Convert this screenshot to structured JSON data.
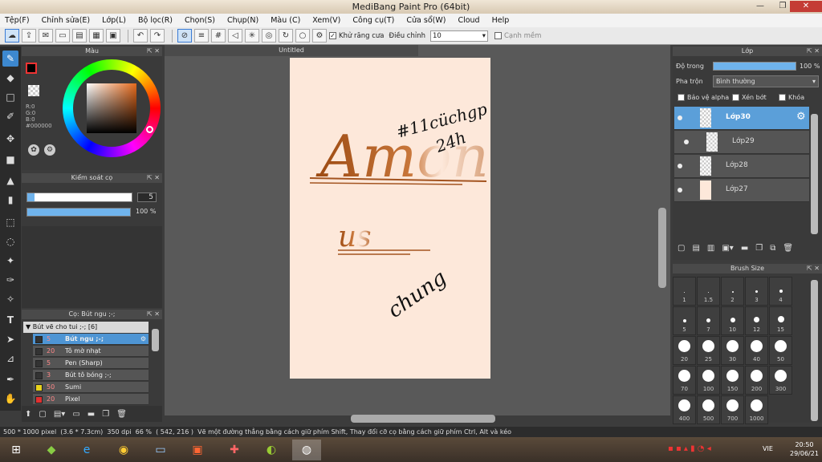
{
  "window": {
    "title": "MediBang Paint Pro (64bit)"
  },
  "menu": [
    "Tệp(F)",
    "Chỉnh sửa(E)",
    "Lớp(L)",
    "Bộ lọc(R)",
    "Chọn(S)",
    "Chụp(N)",
    "Màu (C)",
    "Xem(V)",
    "Công cụ(T)",
    "Cửa sổ(W)",
    "Cloud",
    "Help"
  ],
  "toolbar": {
    "antialias_label": "Khử răng cưa",
    "correction_label": "Điều chỉnh",
    "correction_value": "10",
    "edge_label": "Cạnh mềm"
  },
  "color_panel": {
    "title": "Màu",
    "r": "R:0",
    "g": "G:0",
    "b": "B:0",
    "hex": "#000000"
  },
  "brush_control": {
    "title": "Kiểm soát cọ",
    "size": "5",
    "opacity": "100 %",
    "opacity_fraction": 1.0
  },
  "brush_list": {
    "title": "Cọ: Bút ngu ;-;",
    "group": "Bút vẽ cho tui ;-; [6]",
    "items": [
      {
        "size": "5",
        "name": "Bút ngu ;-;",
        "color": "#333333",
        "selected": true
      },
      {
        "size": "20",
        "name": "Tô mờ nhạt",
        "color": "#333333",
        "selected": false
      },
      {
        "size": "5",
        "name": "Pen (Sharp)",
        "color": "#333333",
        "selected": false
      },
      {
        "size": "3",
        "name": "Bút tô bóng ;-;",
        "color": "#333333",
        "selected": false
      },
      {
        "size": "50",
        "name": "Sumi",
        "color": "#e8d21c",
        "selected": false
      },
      {
        "size": "20",
        "name": "Pixel",
        "color": "#e03030",
        "selected": false
      }
    ]
  },
  "canvas": {
    "tab": "Untitled",
    "text_main": "Among",
    "text_us": "us",
    "text_hashtag": "#11cüchgp",
    "text_24": "24h",
    "text_chung": "chung"
  },
  "layer_panel": {
    "title": "Lớp",
    "opacity_label": "Độ trong",
    "opacity_value": "100 %",
    "blend_label": "Pha trộn",
    "blend_value": "Bình thường",
    "protect_alpha": "Bảo vệ alpha",
    "clipping": "Xén bớt",
    "lock": "Khóa",
    "layers": [
      {
        "name": "Lớp30",
        "selected": true
      },
      {
        "name": "Lớp29",
        "selected": false
      },
      {
        "name": "Lớp28",
        "selected": false
      },
      {
        "name": "Lớp27",
        "selected": false
      }
    ]
  },
  "brush_size": {
    "title": "Brush Size",
    "sizes": [
      "1",
      "1.5",
      "2",
      "3",
      "4",
      "5",
      "7",
      "10",
      "12",
      "15",
      "20",
      "25",
      "30",
      "40",
      "50",
      "70",
      "100",
      "150",
      "200",
      "300",
      "400",
      "500",
      "700",
      "1000"
    ]
  },
  "status": {
    "dimensions": "500 * 1000 pixel",
    "physical": "(3.6 * 7.3cm)",
    "dpi": "350 dpi",
    "zoom": "66 %",
    "coords": "( 542, 216 )",
    "hint": "Vẽ một đường thẳng bằng cách giữ phím Shift, Thay đổi cỡ cọ bằng cách giữ phím Ctrl, Alt và kéo"
  },
  "taskbar": {
    "lang": "VIE",
    "time": "20:50",
    "date": "29/06/21"
  }
}
